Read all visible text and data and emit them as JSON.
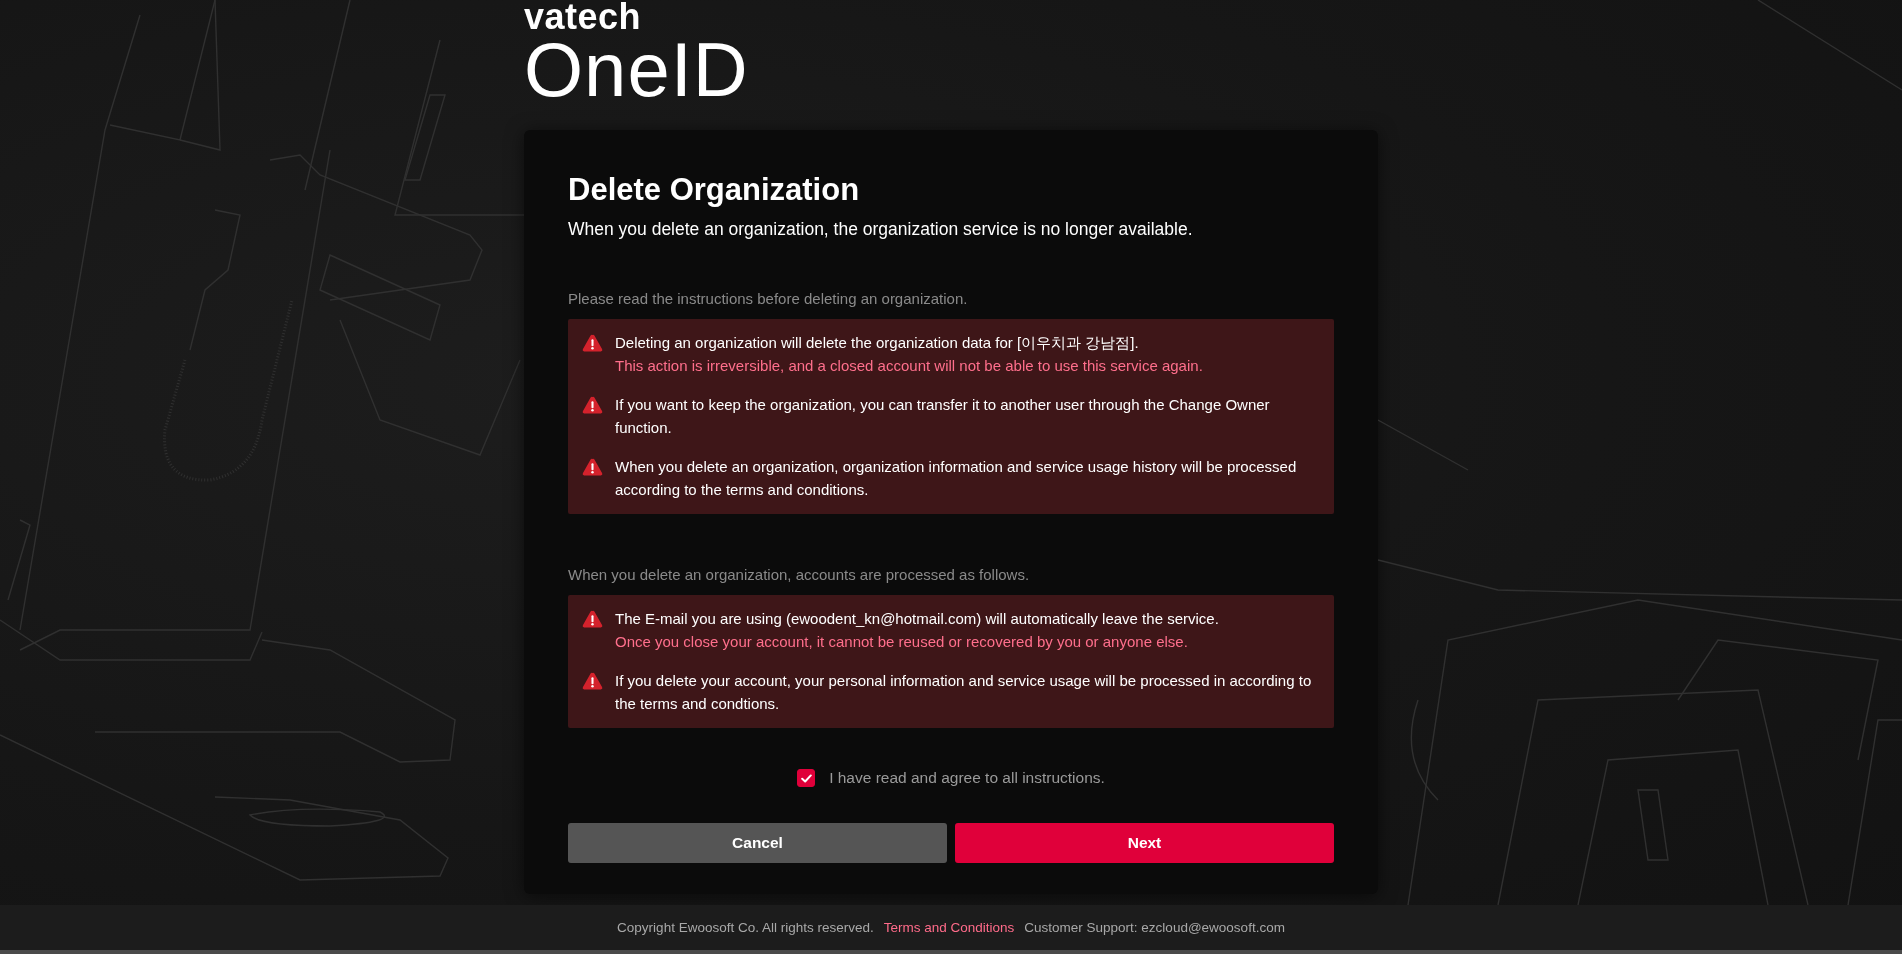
{
  "logo": {
    "brand": "vatech",
    "product": "OneID"
  },
  "card": {
    "title": "Delete Organization",
    "subtitle": "When you delete an organization, the organization service is no longer available."
  },
  "sections": [
    {
      "label": "Please read the instructions before deleting an organization.",
      "notices": [
        {
          "text": "Deleting an organization will delete the organization data for [이우치과 강남점].",
          "warning": "This action is irreversible, and a closed account will not be able to use this service again."
        },
        {
          "text": "If you want to keep the organization, you can transfer it to another user through the Change Owner function."
        },
        {
          "text": "When you delete an organization, organization information and service usage history will be processed according to the terms and conditions."
        }
      ]
    },
    {
      "label": "When you delete an organization, accounts are processed as follows.",
      "notices": [
        {
          "text": "The E-mail you are using (ewoodent_kn@hotmail.com) will automatically leave the service.",
          "warning": "Once you close your account, it cannot be reused or recovered by you or anyone else."
        },
        {
          "text": "If you delete your account, your personal information and service usage will be processed in according to the terms and condtions."
        }
      ]
    }
  ],
  "agreement": {
    "label": "I have read and agree to all instructions.",
    "checked": true
  },
  "buttons": [
    {
      "label": "Cancel",
      "kind": "secondary"
    },
    {
      "label": "Next",
      "kind": "primary"
    }
  ],
  "footer": {
    "copyright": "Copyright Ewoosoft Co. All rights reserved.",
    "link": "Terms and Conditions",
    "support": "Customer Support: ezcloud@ewoosoft.com"
  }
}
